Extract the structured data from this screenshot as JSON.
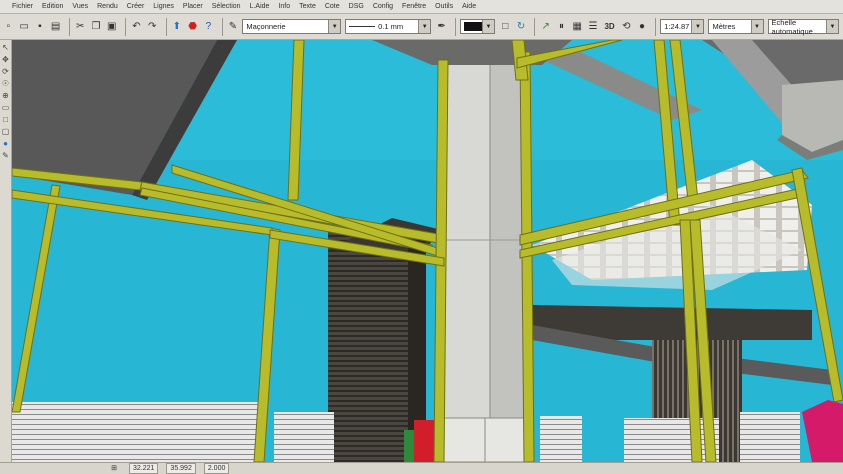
{
  "menu": [
    "Fichier",
    "Edition",
    "Vues",
    "Rendu",
    "Créer",
    "Lignes",
    "Placer",
    "Sélection",
    "L.Aide",
    "Info",
    "Texte",
    "Cote",
    "DSG",
    "Config",
    "Fenêtre",
    "Outils",
    "Aide"
  ],
  "toolbar": {
    "material": "Maçonnerie",
    "line_width": "0.1 mm",
    "scale": "1:24.87",
    "units": "Mètres",
    "scale_mode": "Echelle automatique",
    "view_3d_label": "3D"
  },
  "status": {
    "coord_x": "32.221",
    "coord_y": "35.992",
    "coord_z": "2.000"
  },
  "colors": {
    "sky": "#27b6d4",
    "frame_yellow": "#b8bc2a",
    "column": "#d6d6d2",
    "slab_dark": "#5a5a5a",
    "ui_gray": "#d4d0c8"
  }
}
